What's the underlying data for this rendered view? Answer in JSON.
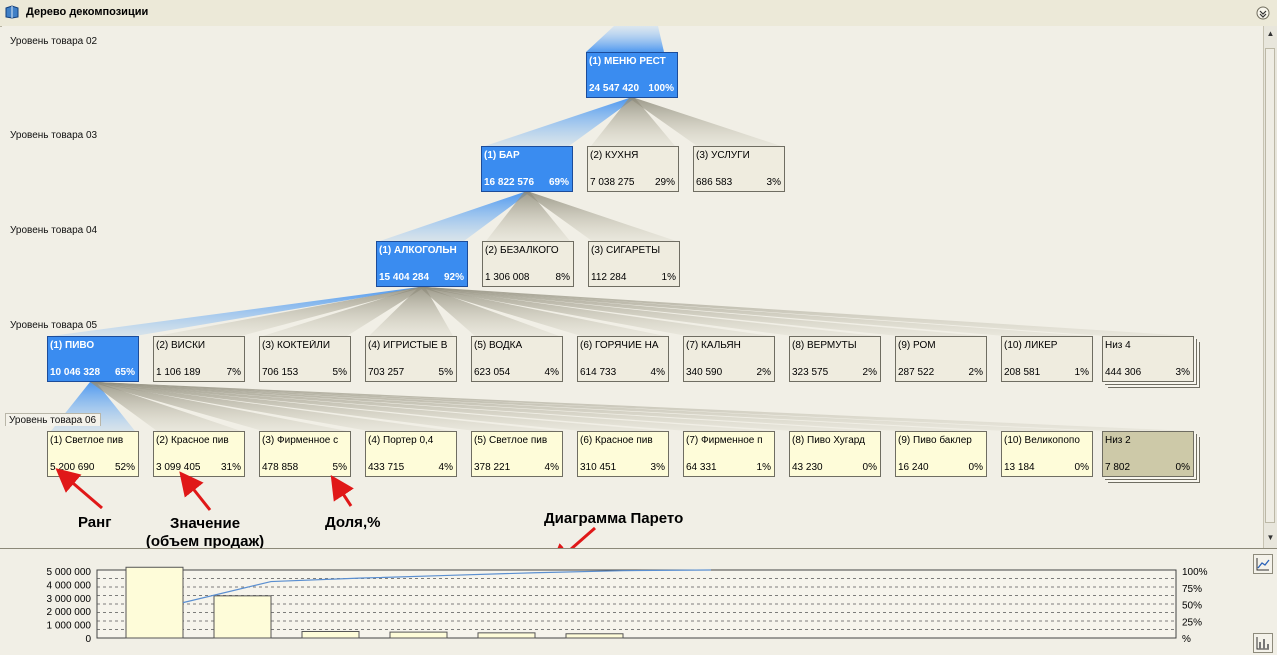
{
  "window": {
    "title": "Дерево декомпозиции"
  },
  "levels": [
    "Уровень товара 02",
    "Уровень товара 03",
    "Уровень товара 04",
    "Уровень товара 05",
    "Уровень товара 06"
  ],
  "tree": {
    "level02": [
      {
        "name": "(1) МЕНЮ РЕСТ",
        "value": "24 547 420",
        "pct": "100%",
        "selected": true
      }
    ],
    "level03": [
      {
        "name": "(1) БАР",
        "value": "16 822 576",
        "pct": "69%",
        "selected": true
      },
      {
        "name": "(2) КУХНЯ",
        "value": "7 038 275",
        "pct": "29%"
      },
      {
        "name": "(3) УСЛУГИ",
        "value": "686 583",
        "pct": "3%"
      }
    ],
    "level04": [
      {
        "name": "(1) АЛКОГОЛЬН",
        "value": "15 404 284",
        "pct": "92%",
        "selected": true
      },
      {
        "name": "(2) БЕЗАЛКОГО",
        "value": "1 306 008",
        "pct": "8%"
      },
      {
        "name": "(3) СИГАРЕТЫ",
        "value": "112 284",
        "pct": "1%"
      }
    ],
    "level05": [
      {
        "name": "(1) ПИВО",
        "value": "10 046 328",
        "pct": "65%",
        "selected": true
      },
      {
        "name": "(2) ВИСКИ",
        "value": "1 106 189",
        "pct": "7%"
      },
      {
        "name": "(3) КОКТЕЙЛИ",
        "value": "706 153",
        "pct": "5%"
      },
      {
        "name": "(4) ИГРИСТЫЕ В",
        "value": "703 257",
        "pct": "5%"
      },
      {
        "name": "(5) ВОДКА",
        "value": "623 054",
        "pct": "4%"
      },
      {
        "name": "(6) ГОРЯЧИЕ НА",
        "value": "614 733",
        "pct": "4%"
      },
      {
        "name": "(7) КАЛЬЯН",
        "value": "340 590",
        "pct": "2%"
      },
      {
        "name": "(8) ВЕРМУТЫ",
        "value": "323 575",
        "pct": "2%"
      },
      {
        "name": "(9) РОМ",
        "value": "287 522",
        "pct": "2%"
      },
      {
        "name": "(10) ЛИКЕР",
        "value": "208 581",
        "pct": "1%"
      },
      {
        "name": "Низ 4",
        "value": "444 306",
        "pct": "3%"
      }
    ],
    "level06": [
      {
        "name": "(1) Светлое пив",
        "value": "5 200 690",
        "pct": "52%"
      },
      {
        "name": "(2) Красное пив",
        "value": "3 099 405",
        "pct": "31%"
      },
      {
        "name": "(3) Фирменное с",
        "value": "478 858",
        "pct": "5%"
      },
      {
        "name": "(4) Портер 0,4",
        "value": "433 715",
        "pct": "4%"
      },
      {
        "name": "(5) Светлое пив",
        "value": "378 221",
        "pct": "4%"
      },
      {
        "name": "(6) Красное пив",
        "value": "310 451",
        "pct": "3%"
      },
      {
        "name": "(7) Фирменное п",
        "value": "64 331",
        "pct": "1%"
      },
      {
        "name": "(8) Пиво  Хугард",
        "value": "43 230",
        "pct": "0%"
      },
      {
        "name": "(9) Пиво баклер",
        "value": "16 240",
        "pct": "0%"
      },
      {
        "name": "(10) Великопопо",
        "value": "13 184",
        "pct": "0%"
      },
      {
        "name": "Низ 2",
        "value": "7 802",
        "pct": "0%"
      }
    ]
  },
  "annotations": {
    "rank": "Ранг",
    "value_line1": "Значение",
    "value_line2": "(объем продаж)",
    "share": "Доля,%",
    "pareto": "Диаграмма Парето"
  },
  "chart_data": {
    "type": "bar",
    "title": "",
    "bars": [
      5200690,
      3099405,
      478858,
      433715,
      378221,
      310451
    ],
    "ylim": [
      0,
      5000000
    ],
    "y_ticks": [
      "5 000 000",
      "4 000 000",
      "3 000 000",
      "2 000 000",
      "1 000 000",
      "0"
    ],
    "y2_ticks": [
      "100%",
      "75%",
      "50%",
      "25%",
      "%"
    ],
    "cumulative_pct": [
      52,
      83,
      88,
      92,
      96,
      99,
      100
    ],
    "grid": true,
    "colors": {
      "bar_fill": "#fefcd9",
      "bar_stroke": "#555555",
      "line": "#5b8fd0"
    }
  }
}
